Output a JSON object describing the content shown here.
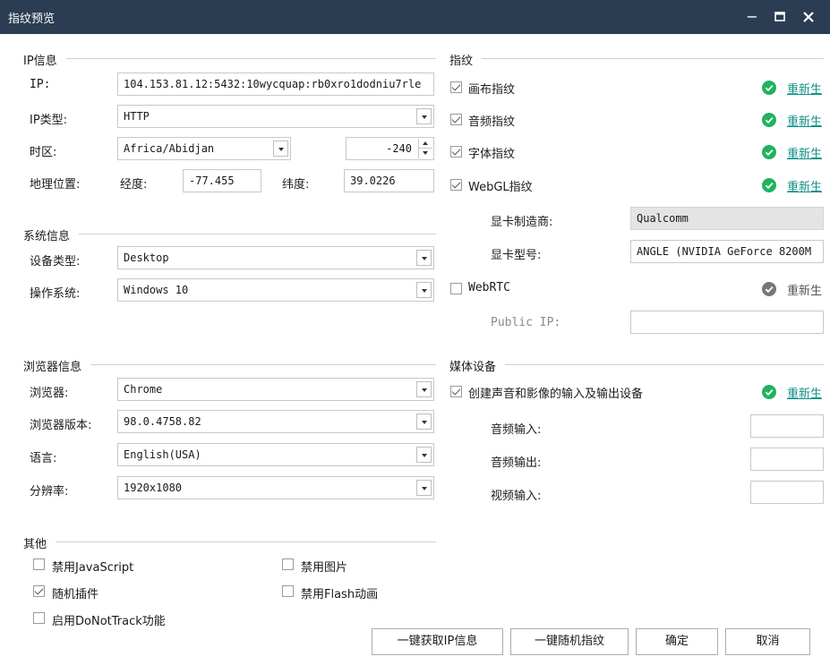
{
  "window": {
    "title": "指纹预览",
    "minimize": "−",
    "maximize": "☐",
    "close": "✕"
  },
  "colors": {
    "titlebar": "#2b3d52",
    "ok_green": "#1fb35f",
    "ok_gray": "#777777",
    "link_teal": "#12908a"
  },
  "ip_info": {
    "section": "IP信息",
    "ip_label": "IP:",
    "ip_value": "104.153.81.12:5432:10wycquap:rb0xro1dodniu7rle",
    "ip_type_label": "IP类型:",
    "ip_type_value": "HTTP",
    "timezone_label": "时区:",
    "timezone_value": "Africa/Abidjan",
    "timezone_offset": "-240",
    "geo_label": "地理位置:",
    "lng_label": "经度:",
    "lng_value": "-77.455",
    "lat_label": "纬度:",
    "lat_value": "39.0226"
  },
  "system_info": {
    "section": "系统信息",
    "device_label": "设备类型:",
    "device_value": "Desktop",
    "os_label": "操作系统:",
    "os_value": "Windows 10"
  },
  "browser_info": {
    "section": "浏览器信息",
    "browser_label": "浏览器:",
    "browser_value": "Chrome",
    "version_label": "浏览器版本:",
    "version_value": "98.0.4758.82",
    "language_label": "语言:",
    "language_value": "English(USA)",
    "resolution_label": "分辨率:",
    "resolution_value": "1920x1080"
  },
  "other": {
    "section": "其他",
    "disable_js": "禁用JavaScript",
    "disable_js_checked": false,
    "disable_images": "禁用图片",
    "disable_images_checked": false,
    "random_plugins": "随机插件",
    "random_plugins_checked": true,
    "disable_flash": "禁用Flash动画",
    "disable_flash_checked": false,
    "dnt": "启用DoNotTrack功能",
    "dnt_checked": false
  },
  "fingerprint": {
    "section": "指纹",
    "canvas": "画布指纹",
    "audio": "音频指纹",
    "font": "字体指纹",
    "webgl": "WebGL指纹",
    "regen": "重新生",
    "gpu_vendor_label": "显卡制造商:",
    "gpu_vendor_value": "Qualcomm",
    "gpu_model_label": "显卡型号:",
    "gpu_model_value": "ANGLE (NVIDIA GeForce 8200M",
    "webrtc": "WebRTC",
    "webrtc_checked": false,
    "public_ip_label": "Public IP:",
    "public_ip_value": ""
  },
  "media": {
    "section": "媒体设备",
    "create_devices": "创建声音和影像的输入及输出设备",
    "create_devices_checked": true,
    "audio_in_label": "音频输入:",
    "audio_in_value": "",
    "audio_out_label": "音频输出:",
    "audio_out_value": "",
    "video_in_label": "视频输入:",
    "video_in_value": ""
  },
  "buttons": {
    "get_ip": "一键获取IP信息",
    "random_fp": "一键随机指纹",
    "ok": "确定",
    "cancel": "取消"
  }
}
